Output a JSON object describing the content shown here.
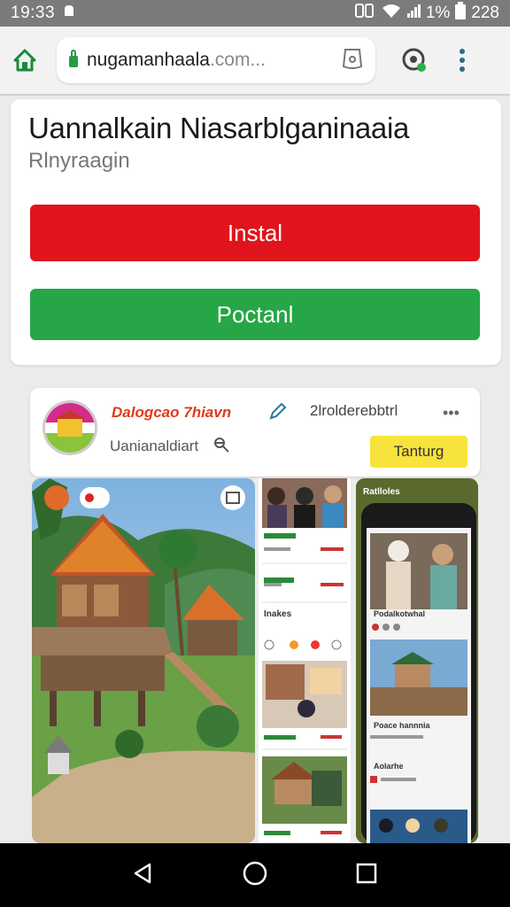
{
  "status_bar": {
    "time": "19:33",
    "battery_percent": "1%",
    "right_text": "228"
  },
  "browser": {
    "url_main": "nugamanhaala",
    "url_tail": ".com...",
    "icons": [
      "home-icon",
      "lock-icon",
      "tab-shield-icon",
      "lens-icon",
      "overflow-menu-icon"
    ]
  },
  "app": {
    "title": "Uannalkain Niasarblganinaaia",
    "subtitle": "Rlnyraagin",
    "install_label": "Instal",
    "open_label": "Poctanl",
    "accent_red": "#e0141c",
    "accent_green": "#26a646"
  },
  "info": {
    "developer": "Dalogcao 7hiavn",
    "downloads": "2lrolderebbtrl",
    "category": "Uanianaldiart",
    "tag_label": "Tanturg",
    "tag_color": "#f7e33c"
  },
  "screenshots": {
    "list_section_title": "Inakes",
    "phone_header": "Ratlloles",
    "phone_row_1": "Podalkotwhal",
    "phone_row_2": "Poace hannnia",
    "phone_row_3": "Aolarhe"
  },
  "nav": {
    "icons": [
      "back-icon",
      "home-circle-icon",
      "recents-icon"
    ]
  }
}
